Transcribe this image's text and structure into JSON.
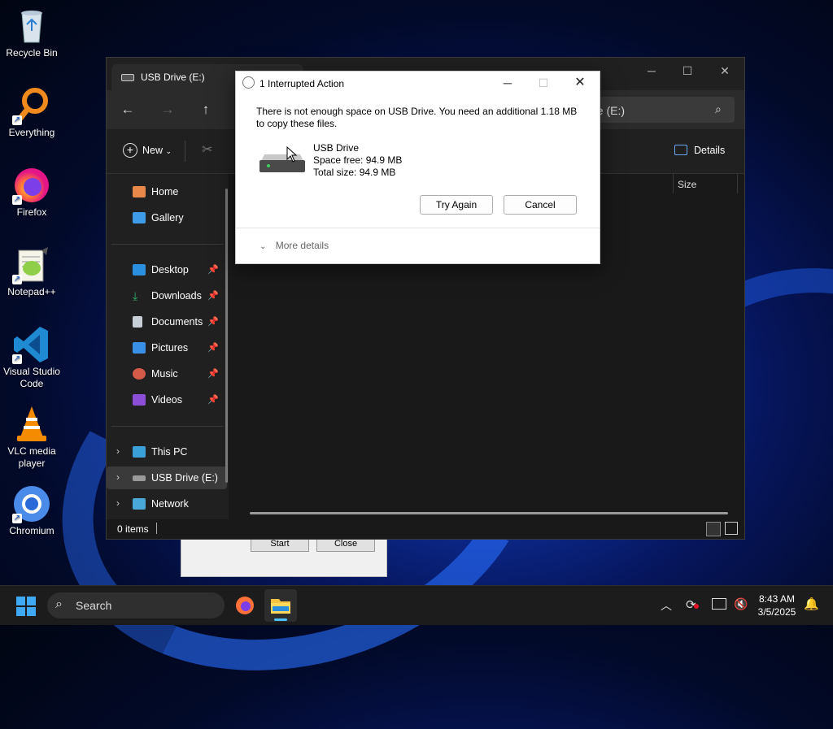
{
  "desktop": {
    "icons": [
      {
        "label": "Recycle Bin",
        "icon": "recycle-bin-icon"
      },
      {
        "label": "Everything",
        "icon": "everything-search-icon"
      },
      {
        "label": "Firefox",
        "icon": "firefox-icon"
      },
      {
        "label": "Notepad++",
        "icon": "notepad-plus-plus-icon"
      },
      {
        "label": "Visual Studio Code",
        "icon": "vscode-icon"
      },
      {
        "label": "VLC media player",
        "icon": "vlc-icon"
      },
      {
        "label": "Chromium",
        "icon": "chromium-icon"
      }
    ]
  },
  "background_window": {
    "start_label": "Start",
    "close_label": "Close"
  },
  "explorer": {
    "tab_title": "USB Drive (E:)",
    "address_text": "rive (E:)",
    "new_label": "New",
    "details_label": "Details",
    "column_size": "Size",
    "sidebar": {
      "home": "Home",
      "gallery": "Gallery",
      "desktop": "Desktop",
      "downloads": "Downloads",
      "documents": "Documents",
      "pictures": "Pictures",
      "music": "Music",
      "videos": "Videos",
      "this_pc": "This PC",
      "usb_drive": "USB Drive (E:)",
      "network": "Network"
    },
    "status_text": "0 items"
  },
  "dialog": {
    "title": "1 Interrupted Action",
    "message_line1": "There is not enough space on USB Drive. You need an additional 1.18 MB",
    "message_line2": "to copy these files.",
    "drive_name": "USB Drive",
    "space_free": "Space free: 94.9 MB",
    "total_size": "Total size: 94.9 MB",
    "try_again_label": "Try Again",
    "cancel_label": "Cancel",
    "more_details_label": "More details"
  },
  "taskbar": {
    "search_placeholder": "Search",
    "time": "8:43 AM",
    "date": "3/5/2025"
  },
  "colors": {
    "accent": "#0067c0",
    "dialog_bg": "#ffffff",
    "explorer_bg": "#191919"
  }
}
